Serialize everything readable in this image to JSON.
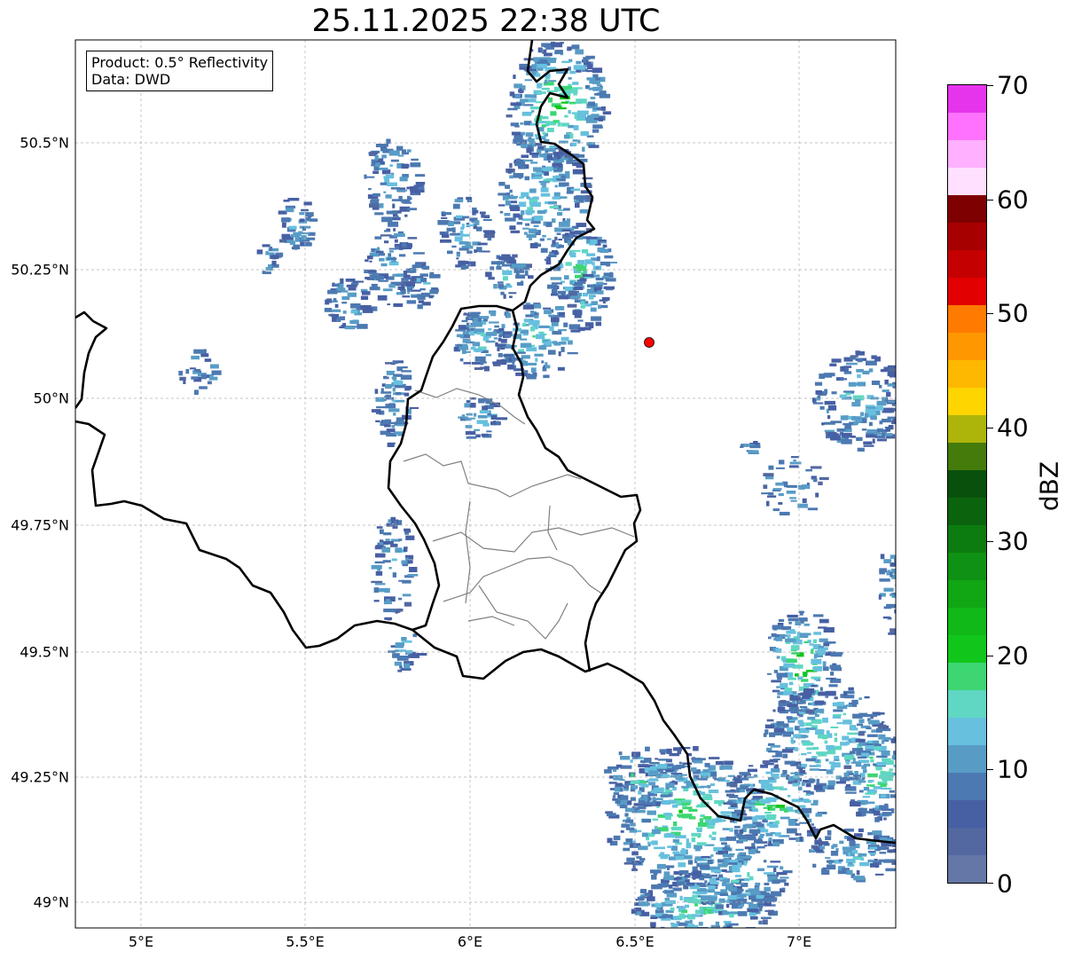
{
  "title": "25.11.2025 22:38 UTC",
  "info_box": {
    "product": "Product: 0.5° Reflectivity",
    "data": "Data: DWD"
  },
  "axes": {
    "x_ticks": [
      "5°E",
      "5.5°E",
      "6°E",
      "6.5°E",
      "7°E"
    ],
    "y_ticks": [
      "50.5°N",
      "50.25°N",
      "50°N",
      "49.75°N",
      "49.5°N",
      "49.25°N",
      "49°N"
    ]
  },
  "colorbar": {
    "label": "dBZ",
    "ticks": [
      "0",
      "10",
      "20",
      "30",
      "40",
      "50",
      "60",
      "70"
    ],
    "range": [
      0,
      70
    ],
    "step": 2.5,
    "colors": [
      "#6577a6",
      "#5368a0",
      "#4760a4",
      "#4c79b1",
      "#589cc6",
      "#66c0de",
      "#5fd7c3",
      "#3dd673",
      "#11c61a",
      "#10b818",
      "#10a614",
      "#0f9213",
      "#0d7c10",
      "#0b640d",
      "#08500b",
      "#447b0b",
      "#adb40a",
      "#ffd500",
      "#ffb800",
      "#ff9700",
      "#ff7a00",
      "#e20000",
      "#c40000",
      "#a60000",
      "#7f0000",
      "#ffe0ff",
      "#ffb0ff",
      "#ff72ff",
      "#e634ec"
    ]
  },
  "marker": {
    "lon": 6.55,
    "lat": 50.11,
    "color": "#ff0000"
  },
  "colors": {
    "border": "#000000",
    "internal_border": "#808080",
    "grid": "#b0b0b0"
  }
}
